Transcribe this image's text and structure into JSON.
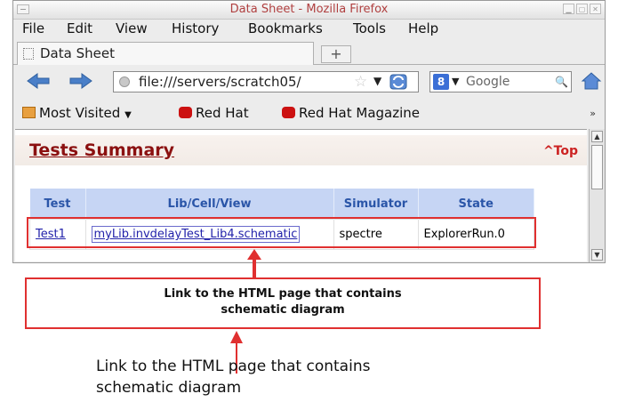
{
  "window": {
    "title": "Data Sheet - Mozilla Firefox"
  },
  "menubar": [
    "File",
    "Edit",
    "View",
    "History",
    "Bookmarks",
    "Tools",
    "Help"
  ],
  "tab": {
    "label": "Data Sheet",
    "new_tab_label": "+"
  },
  "navbar": {
    "url": "file:///servers/scratch05/",
    "search_placeholder": "Google",
    "search_engine_letter": "8"
  },
  "bookmarks": {
    "items": [
      "Most Visited",
      "Red Hat",
      "Red Hat Magazine"
    ],
    "overflow": "»"
  },
  "page": {
    "section_title": "Tests Summary",
    "top_link": "^Top",
    "table": {
      "headers": [
        "Test",
        "Lib/Cell/View",
        "Simulator",
        "State"
      ],
      "rows": [
        {
          "test": "Test1",
          "libcellview": "myLib.invdelayTest_Lib4.schematic",
          "simulator": "spectre",
          "state": "ExplorerRun.0"
        }
      ]
    }
  },
  "annotations": {
    "callout": "Link to the HTML page that contains\nschematic diagram",
    "caption": "Link to the HTML page that contains\nschematic diagram"
  },
  "colors": {
    "accent_red": "#e03030",
    "title_red": "#8b1010",
    "header_blue": "#c6d5f4"
  }
}
